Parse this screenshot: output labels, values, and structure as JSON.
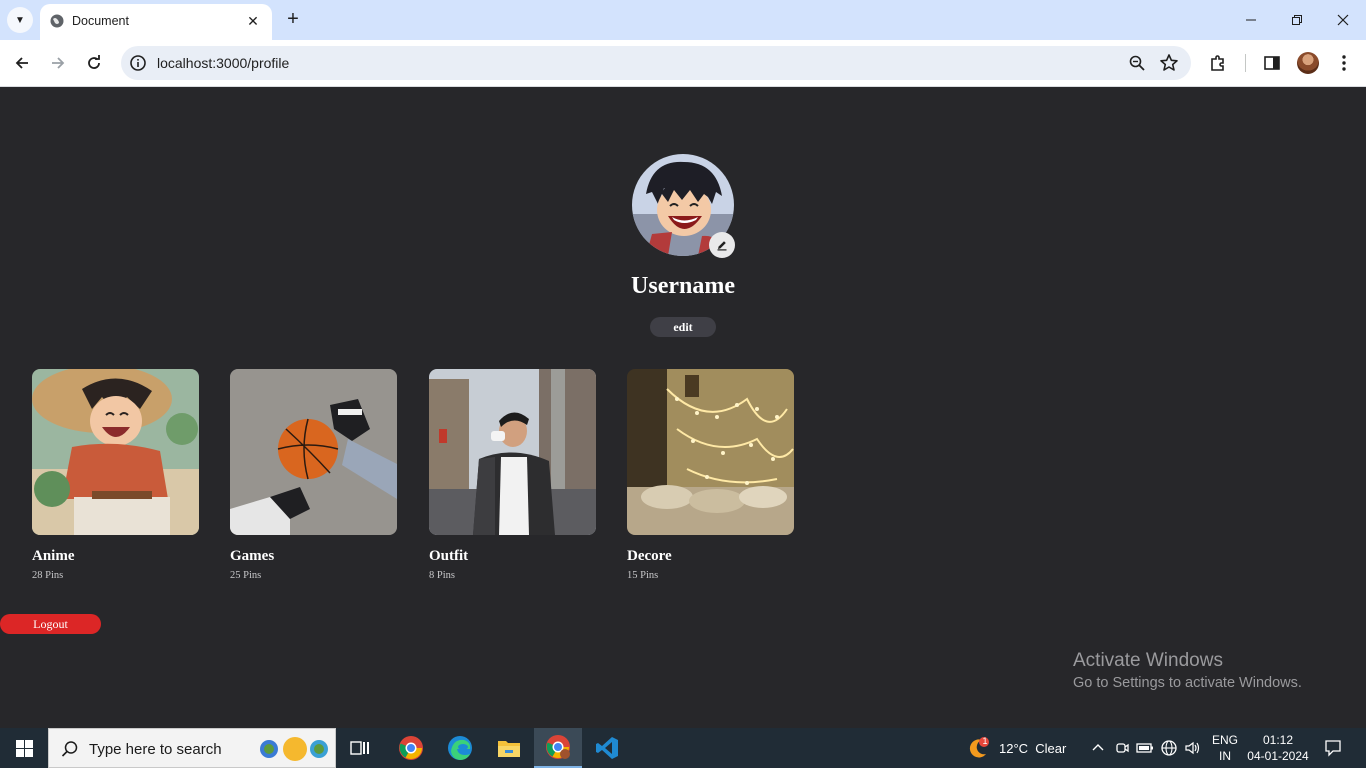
{
  "browser": {
    "tab_title": "Document",
    "url": "localhost:3000/profile"
  },
  "profile": {
    "username": "Username",
    "edit_label": "edit",
    "logout_label": "Logout"
  },
  "boards": [
    {
      "name": "Anime",
      "pins": "28 Pins"
    },
    {
      "name": "Games",
      "pins": "25 Pins"
    },
    {
      "name": "Outfit",
      "pins": "8 Pins"
    },
    {
      "name": "Decore",
      "pins": "15 Pins"
    }
  ],
  "watermark": {
    "title": "Activate Windows",
    "subtitle": "Go to Settings to activate Windows."
  },
  "taskbar": {
    "search_placeholder": "Type here to search",
    "weather": "12°C  Clear",
    "weather_badge": "1",
    "lang_line1": "ENG",
    "lang_line2": "IN",
    "time": "01:12",
    "date": "04-01-2024"
  },
  "colors": {
    "page_bg": "#27272a",
    "logout": "#dc2626",
    "edit_btn": "#3f3f46",
    "chrome_tabstrip": "#d3e3fd"
  }
}
